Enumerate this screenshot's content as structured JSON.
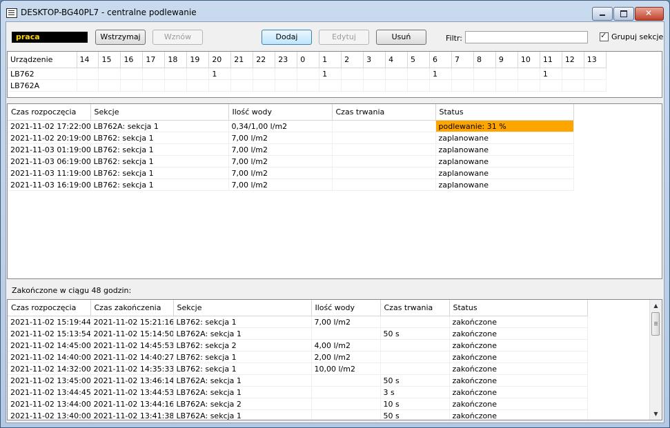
{
  "window": {
    "title": "DESKTOP-BG40PL7 - centralne podlewanie"
  },
  "toolbar": {
    "state": "praca",
    "pause_label": "Wstrzymaj",
    "resume_label": "Wznów",
    "add_label": "Dodaj",
    "edit_label": "Edytuj",
    "delete_label": "Usuń",
    "filter_label": "Filtr:",
    "filter_value": "",
    "group_label": "Grupuj sekcje",
    "group_checked": true
  },
  "schedule": {
    "device_header": "Urządzenie",
    "hours": [
      "14",
      "15",
      "16",
      "17",
      "18",
      "19",
      "20",
      "21",
      "22",
      "23",
      "0",
      "1",
      "2",
      "3",
      "4",
      "5",
      "6",
      "7",
      "8",
      "9",
      "10",
      "11",
      "12",
      "13"
    ],
    "rows": [
      {
        "device": "LB762",
        "cells": [
          "",
          "",
          "",
          "",
          "",
          "",
          "1",
          "",
          "",
          "",
          "",
          "1",
          "",
          "",
          "",
          "",
          "1",
          "",
          "",
          "",
          "",
          "1",
          "",
          ""
        ]
      },
      {
        "device": "LB762A",
        "cells": [
          "",
          "",
          "",
          "",
          "",
          "",
          "",
          "",
          "",
          "",
          "",
          "",
          "",
          "",
          "",
          "",
          "",
          "",
          "",
          "",
          "",
          "",
          "",
          ""
        ]
      }
    ]
  },
  "planned": {
    "headers": [
      "Czas rozpoczęcia",
      "Sekcje",
      "Ilość wody",
      "Czas trwania",
      "Status"
    ],
    "rows": [
      [
        "2021-11-02 17:22:00",
        "LB762A: sekcja 1",
        "0,34/1,00 l/m2",
        "",
        "podlewanie: 31 %"
      ],
      [
        "2021-11-02 20:19:00",
        "LB762: sekcja 1",
        "7,00 l/m2",
        "",
        "zaplanowane"
      ],
      [
        "2021-11-03 01:19:00",
        "LB762: sekcja 1",
        "7,00 l/m2",
        "",
        "zaplanowane"
      ],
      [
        "2021-11-03 06:19:00",
        "LB762: sekcja 1",
        "7,00 l/m2",
        "",
        "zaplanowane"
      ],
      [
        "2021-11-03 11:19:00",
        "LB762: sekcja 1",
        "7,00 l/m2",
        "",
        "zaplanowane"
      ],
      [
        "2021-11-03 16:19:00",
        "LB762: sekcja 1",
        "7,00 l/m2",
        "",
        "zaplanowane"
      ]
    ],
    "active_color": "#ffa500"
  },
  "finished": {
    "section_label": "Zakończone w ciągu 48 godzin:",
    "headers": [
      "Czas rozpoczęcia",
      "Czas zakończenia",
      "Sekcje",
      "Ilość wody",
      "Czas trwania",
      "Status"
    ],
    "rows": [
      [
        "2021-11-02 15:19:44",
        "2021-11-02 15:21:16",
        "LB762: sekcja 1",
        "7,00 l/m2",
        "",
        "zakończone"
      ],
      [
        "2021-11-02 15:13:54",
        "2021-11-02 15:14:50",
        "LB762A: sekcja 1",
        "",
        "50 s",
        "zakończone"
      ],
      [
        "2021-11-02 14:45:00",
        "2021-11-02 14:45:53",
        "LB762: sekcja 2",
        "4,00 l/m2",
        "",
        "zakończone"
      ],
      [
        "2021-11-02 14:40:00",
        "2021-11-02 14:40:27",
        "LB762: sekcja 1",
        "2,00 l/m2",
        "",
        "zakończone"
      ],
      [
        "2021-11-02 14:32:00",
        "2021-11-02 14:35:33",
        "LB762: sekcja 1",
        "10,00 l/m2",
        "",
        "zakończone"
      ],
      [
        "2021-11-02 13:45:00",
        "2021-11-02 13:46:14",
        "LB762A: sekcja 1",
        "",
        "50 s",
        "zakończone"
      ],
      [
        "2021-11-02 13:44:45",
        "2021-11-02 13:44:53",
        "LB762A: sekcja 1",
        "",
        "3 s",
        "zakończone"
      ],
      [
        "2021-11-02 13:44:00",
        "2021-11-02 13:44:16",
        "LB762A: sekcja 2",
        "",
        "10 s",
        "zakończone"
      ],
      [
        "2021-11-02 13:40:00",
        "2021-11-02 13:41:38",
        "LB762A: sekcja 1",
        "",
        "50 s",
        "zakończone"
      ]
    ]
  }
}
